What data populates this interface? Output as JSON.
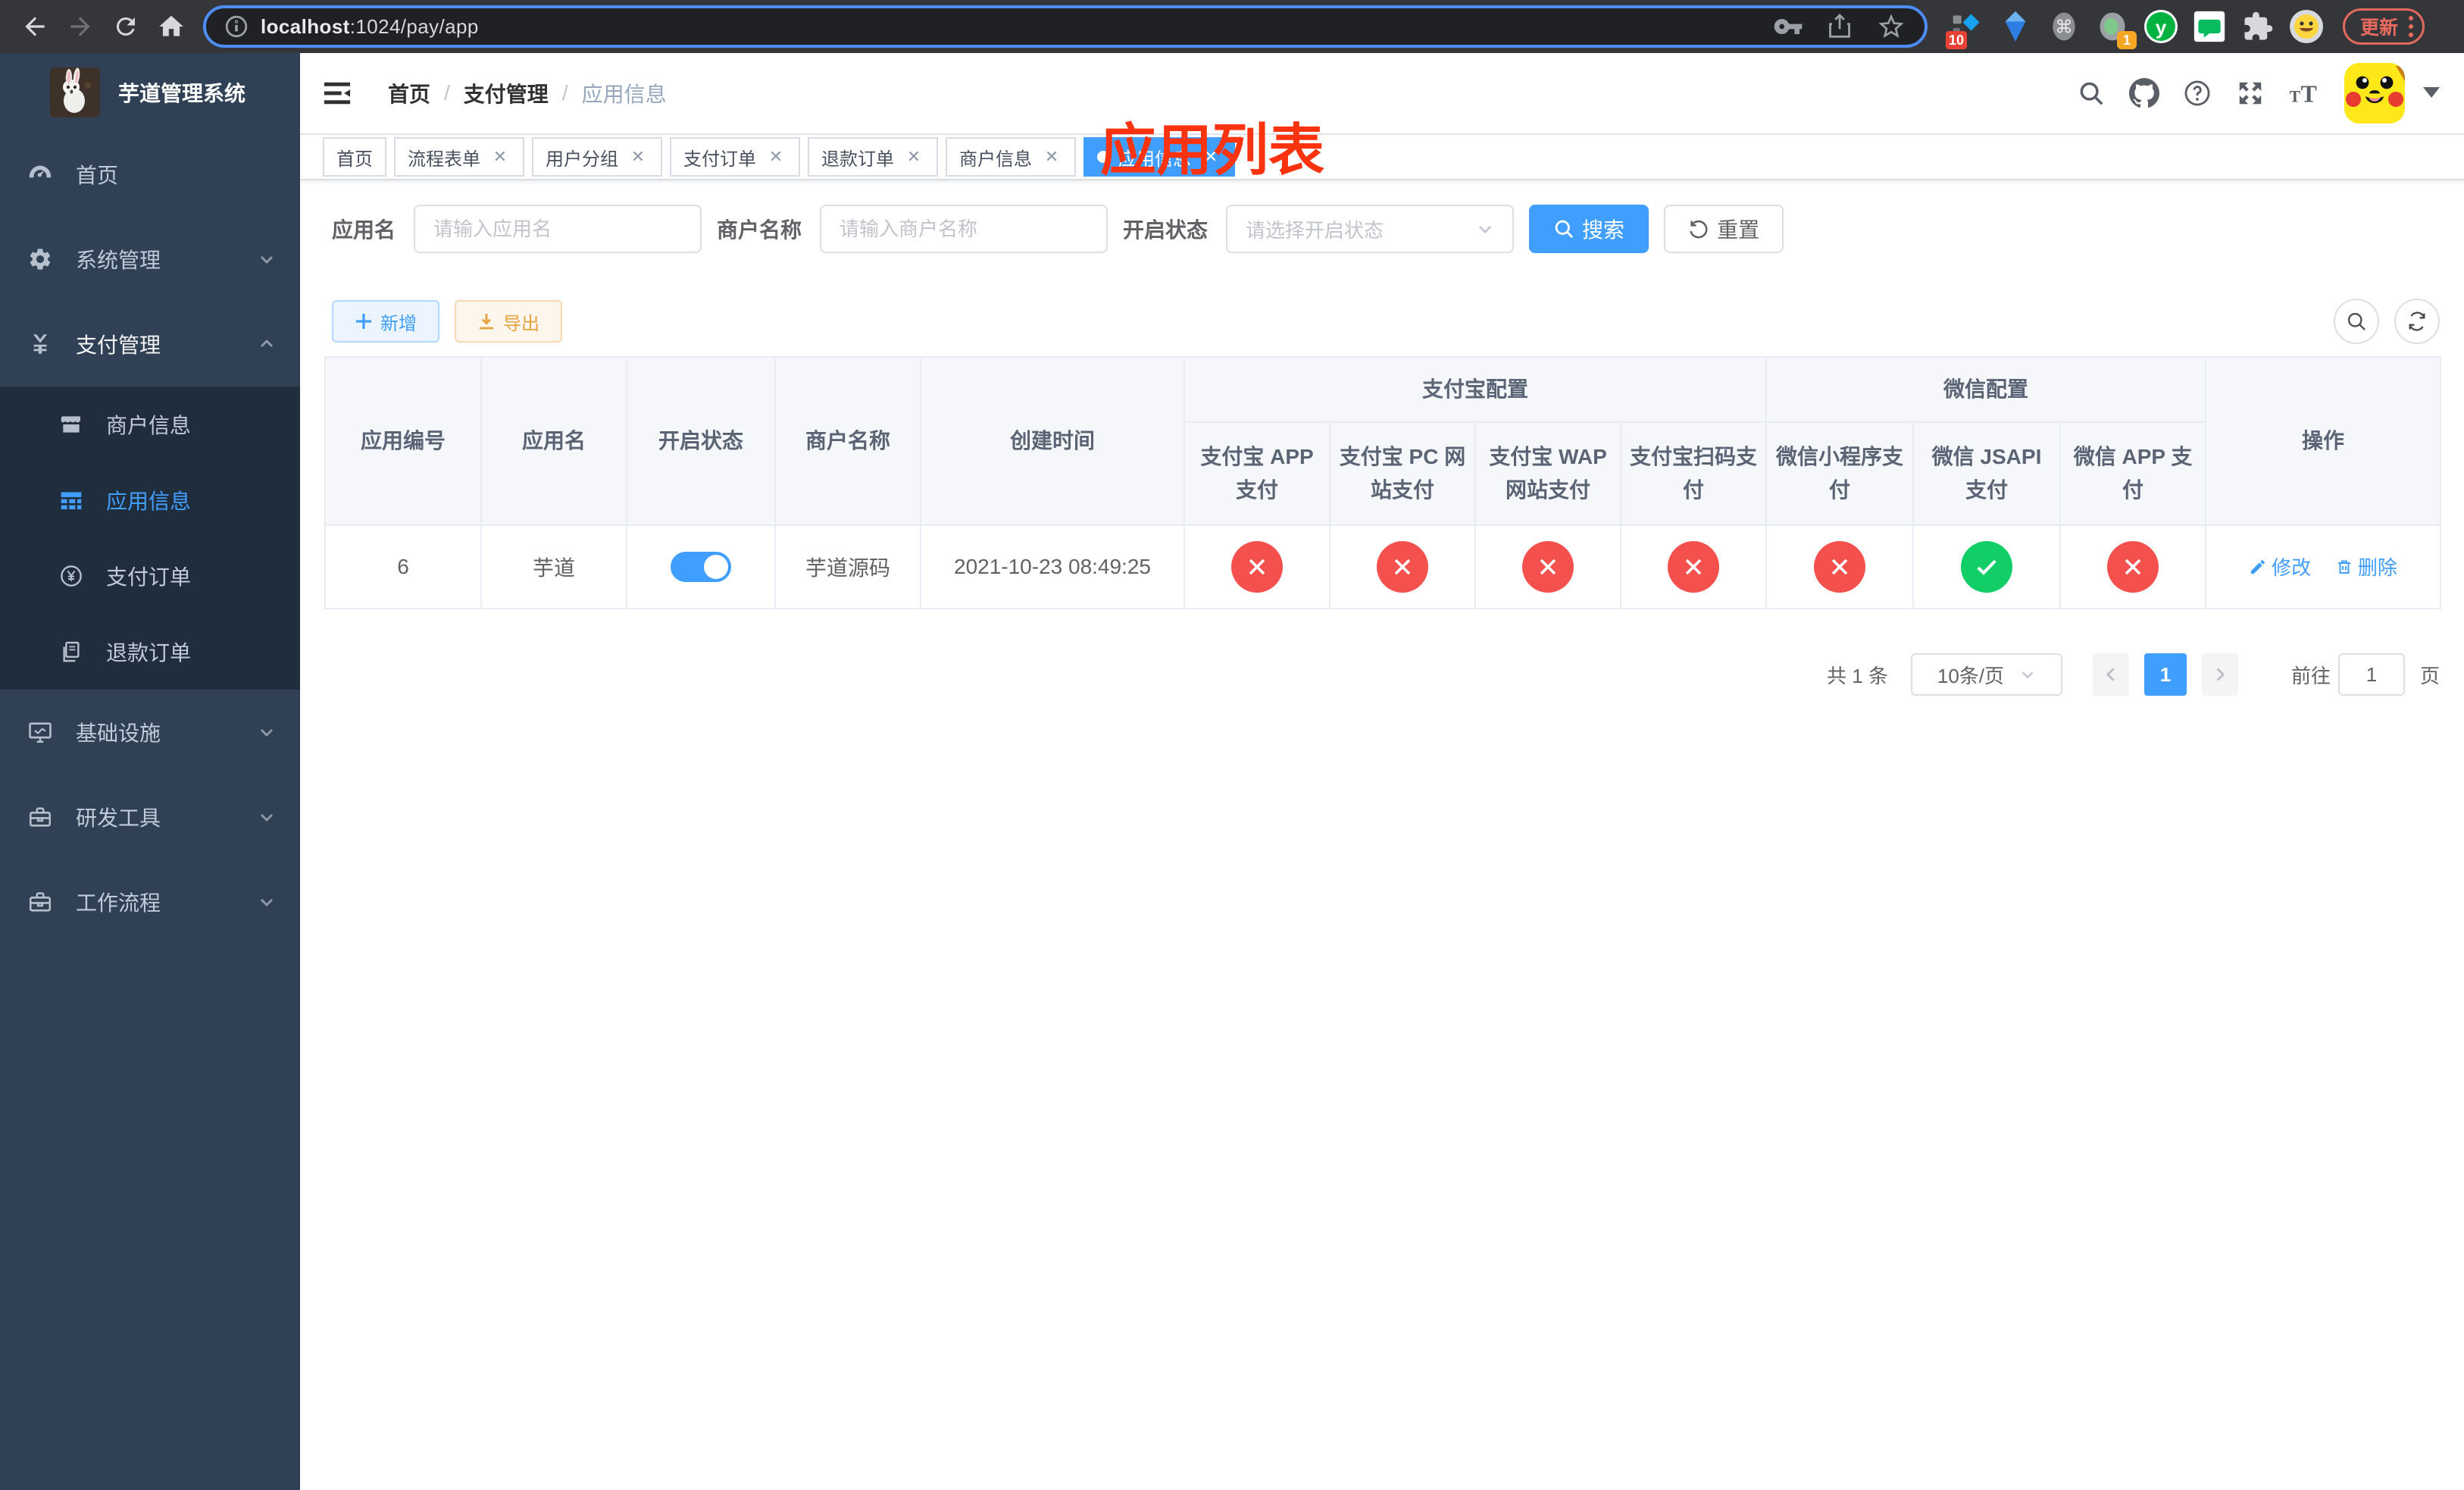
{
  "browser": {
    "url_host": "localhost",
    "url_rest": ":1024/pay/app",
    "update_label": "更新",
    "ext_badge_1": "10",
    "ext_badge_2": "1"
  },
  "sidebar": {
    "title": "芋道管理系统",
    "items": [
      {
        "label": "首页"
      },
      {
        "label": "系统管理"
      },
      {
        "label": "支付管理"
      },
      {
        "label": "基础设施"
      },
      {
        "label": "研发工具"
      },
      {
        "label": "工作流程"
      }
    ],
    "subitems": [
      {
        "label": "商户信息"
      },
      {
        "label": "应用信息"
      },
      {
        "label": "支付订单"
      },
      {
        "label": "退款订单"
      }
    ]
  },
  "navbar": {
    "breadcrumb": [
      "首页",
      "支付管理",
      "应用信息"
    ],
    "annotation": "应用列表"
  },
  "tabs": [
    {
      "label": "首页"
    },
    {
      "label": "流程表单"
    },
    {
      "label": "用户分组"
    },
    {
      "label": "支付订单"
    },
    {
      "label": "退款订单"
    },
    {
      "label": "商户信息"
    },
    {
      "label": "应用信息"
    }
  ],
  "filter": {
    "app_name_label": "应用名",
    "app_name_placeholder": "请输入应用名",
    "merchant_label": "商户名称",
    "merchant_placeholder": "请输入商户名称",
    "status_label": "开启状态",
    "status_placeholder": "请选择开启状态",
    "search_label": "搜索",
    "reset_label": "重置"
  },
  "toolbar": {
    "add_label": "新增",
    "export_label": "导出"
  },
  "table": {
    "group_alipay": "支付宝配置",
    "group_wechat": "微信配置",
    "headers": [
      "应用编号",
      "应用名",
      "开启状态",
      "商户名称",
      "创建时间",
      "操作"
    ],
    "sub_headers": [
      "支付宝 APP 支付",
      "支付宝 PC 网站支付",
      "支付宝 WAP 网站支付",
      "支付宝扫码支付",
      "微信小程序支付",
      "微信 JSAPI 支付",
      "微信 APP 支付"
    ],
    "row": {
      "id": "6",
      "name": "芋道",
      "merchant": "芋道源码",
      "created": "2021-10-23 08:49:25",
      "statuses": [
        "fail",
        "fail",
        "fail",
        "fail",
        "fail",
        "pass",
        "fail"
      ],
      "edit_label": "修改",
      "delete_label": "删除"
    }
  },
  "pagination": {
    "total": "共 1 条",
    "page_size": "10条/页",
    "current_page": "1",
    "goto_label": "前往",
    "goto_value": "1",
    "page_label": "页"
  }
}
